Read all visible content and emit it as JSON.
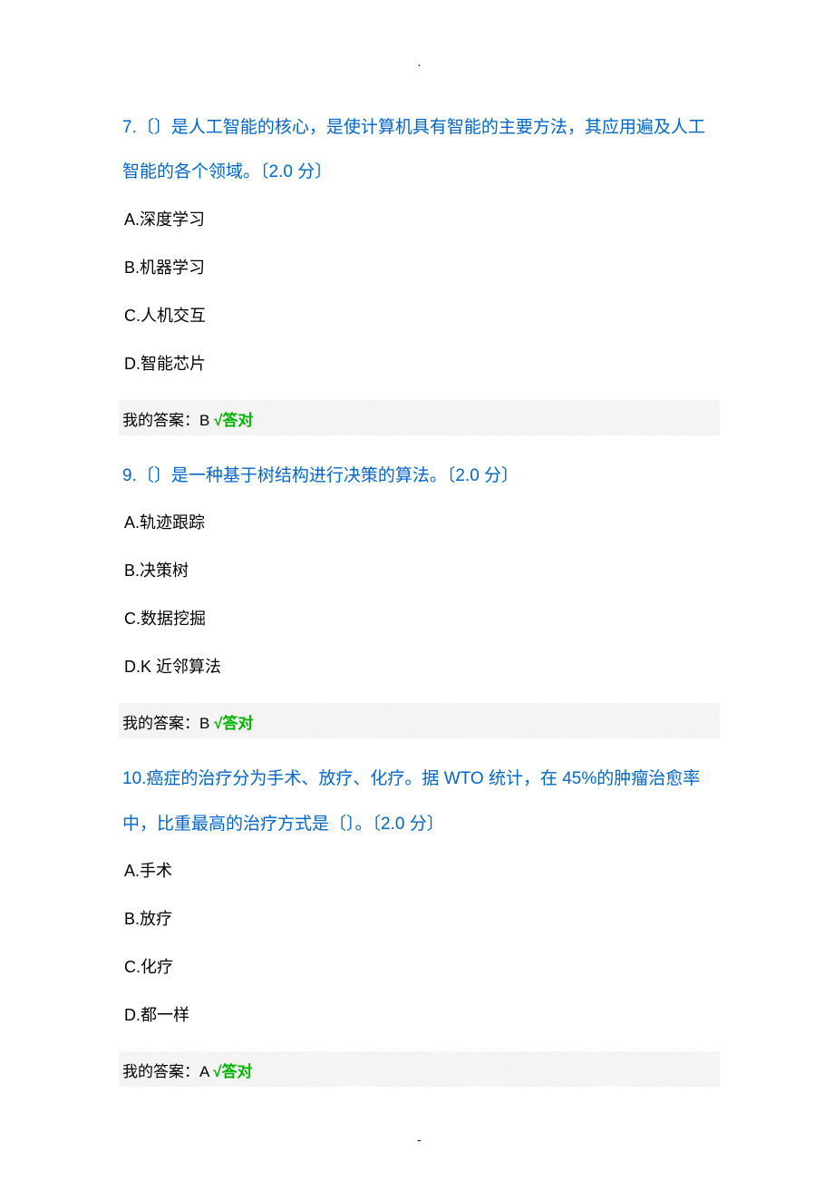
{
  "top_marker": ".",
  "bottom_marker": "-",
  "questions": [
    {
      "number_prefix": "7.",
      "text": "〔〕是人工智能的核心，是使计算机具有智能的主要方法，其应用遍及人工智能的各个领域。〔2.0 分〕",
      "options": {
        "a": "A.深度学习",
        "b": "B.机器学习",
        "c": "C.人机交互",
        "d": "D.智能芯片"
      },
      "answer_label": "我的答案：B ",
      "answer_result": "√答对"
    },
    {
      "number_prefix": "9.",
      "text": "〔〕是一种基于树结构进行决策的算法。〔2.0 分〕",
      "options": {
        "a": "A.轨迹跟踪",
        "b": "B.决策树",
        "c": "C.数据挖掘",
        "d": "D.K 近邻算法"
      },
      "answer_label": "我的答案：B ",
      "answer_result": "√答对"
    },
    {
      "number_prefix": "10.",
      "text": "癌症的治疗分为手术、放疗、化疗。据 WTO 统计，在 45%的肿瘤治愈率中，比重最高的治疗方式是〔〕。〔2.0 分〕",
      "options": {
        "a": "A.手术",
        "b": "B.放疗",
        "c": "C.化疗",
        "d": "D.都一样"
      },
      "answer_label": "我的答案：A ",
      "answer_result": "√答对"
    }
  ]
}
